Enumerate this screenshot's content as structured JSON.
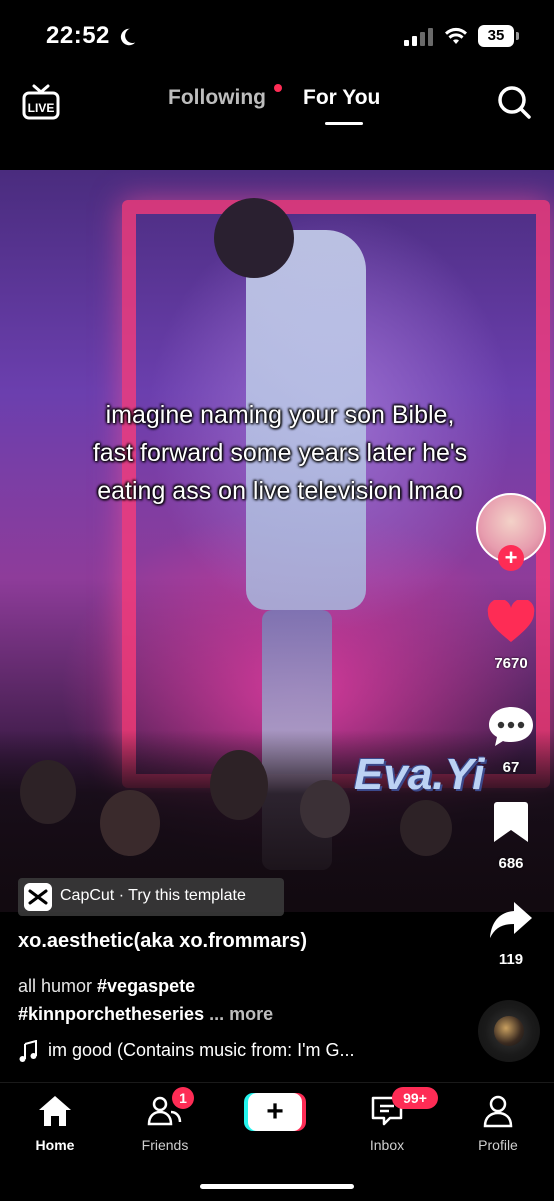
{
  "status_bar": {
    "time": "22:52",
    "battery": "35"
  },
  "header": {
    "live_label": "LIVE",
    "tabs": [
      {
        "label": "Following"
      },
      {
        "label": "For You"
      }
    ]
  },
  "video": {
    "caption": "imagine naming your son Bible, fast forward some years later he's eating ass on live television lmao",
    "watermark": "Eva.Yi"
  },
  "actions": {
    "likes": "7670",
    "comments": "67",
    "saves": "686",
    "shares": "119"
  },
  "template": {
    "label": "CapCut · Try this template"
  },
  "post": {
    "username": "xo.aesthetic(aka xo.frommars)",
    "desc_prefix": "all humor ",
    "hashtag1": "#vegaspete",
    "hashtag2": "#kinnporchetheseries",
    "more": "... more",
    "music": "im good (Contains music from: I'm G..."
  },
  "nav": {
    "home": "Home",
    "friends": "Friends",
    "friends_badge": "1",
    "create": "+",
    "inbox": "Inbox",
    "inbox_badge": "99+",
    "profile": "Profile"
  },
  "colors": {
    "accent": "#fe2c55",
    "teal": "#25f4ee",
    "background": "#000000"
  }
}
